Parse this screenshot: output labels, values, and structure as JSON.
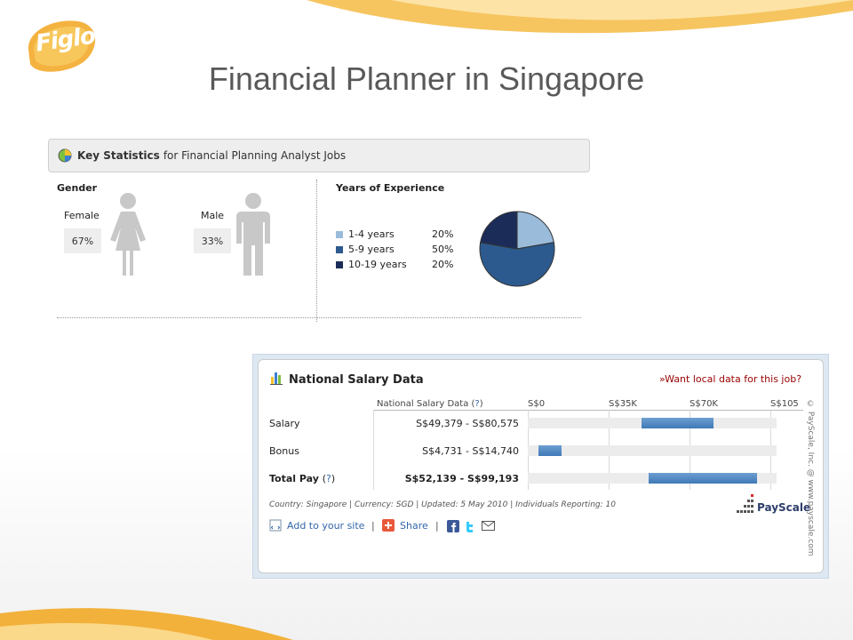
{
  "page": {
    "title": "Financial Planner in Singapore"
  },
  "brand": {
    "logo_text": "Figlo"
  },
  "key_stats": {
    "header_bold": "Key Statistics",
    "header_rest": "for Financial Planning Analyst Jobs",
    "gender": {
      "label": "Gender",
      "female_label": "Female",
      "female_pct": "67%",
      "male_label": "Male",
      "male_pct": "33%"
    },
    "experience": {
      "label": "Years of Experience",
      "items": [
        {
          "label": "1-4 years",
          "pct": "20%",
          "value": 20,
          "color": "#9bbbdb"
        },
        {
          "label": "5-9 years",
          "pct": "50%",
          "value": 50,
          "color": "#2c5a8e"
        },
        {
          "label": "10-19 years",
          "pct": "20%",
          "value": 20,
          "color": "#1b2c58"
        }
      ]
    }
  },
  "salary": {
    "title": "National Salary Data",
    "local_link_arrow": "»",
    "local_link": "Want local data for this job?",
    "column_header": "National Salary Data",
    "question": "?",
    "axis_ticks": [
      "S$0",
      "S$35K",
      "S$70K",
      "S$105"
    ],
    "axis_max": 105000,
    "rows": [
      {
        "label": "Salary",
        "range": "S$49,379 - S$80,575",
        "low": 49379,
        "high": 80575,
        "bold": false
      },
      {
        "label": "Bonus",
        "range": "S$4,731 - S$14,740",
        "low": 4731,
        "high": 14740,
        "bold": false
      },
      {
        "label": "Total Pay",
        "range": "S$52,139 - S$99,193",
        "low": 52139,
        "high": 99193,
        "bold": true
      }
    ],
    "open_paren": "(",
    "close_paren": ")",
    "footer": "Country: Singapore | Currency: SGD | Updated: 5 May 2010 | Individuals Reporting: 10",
    "add_site": "Add to your site",
    "pipe": "|",
    "share": "Share",
    "brand": "PayScale",
    "vertical_copyright": "© PayScale, Inc. @ www.payscale.com"
  },
  "colors": {
    "accent": "#f2b13b",
    "bar": "#3f79b6",
    "title": "#595959"
  }
}
